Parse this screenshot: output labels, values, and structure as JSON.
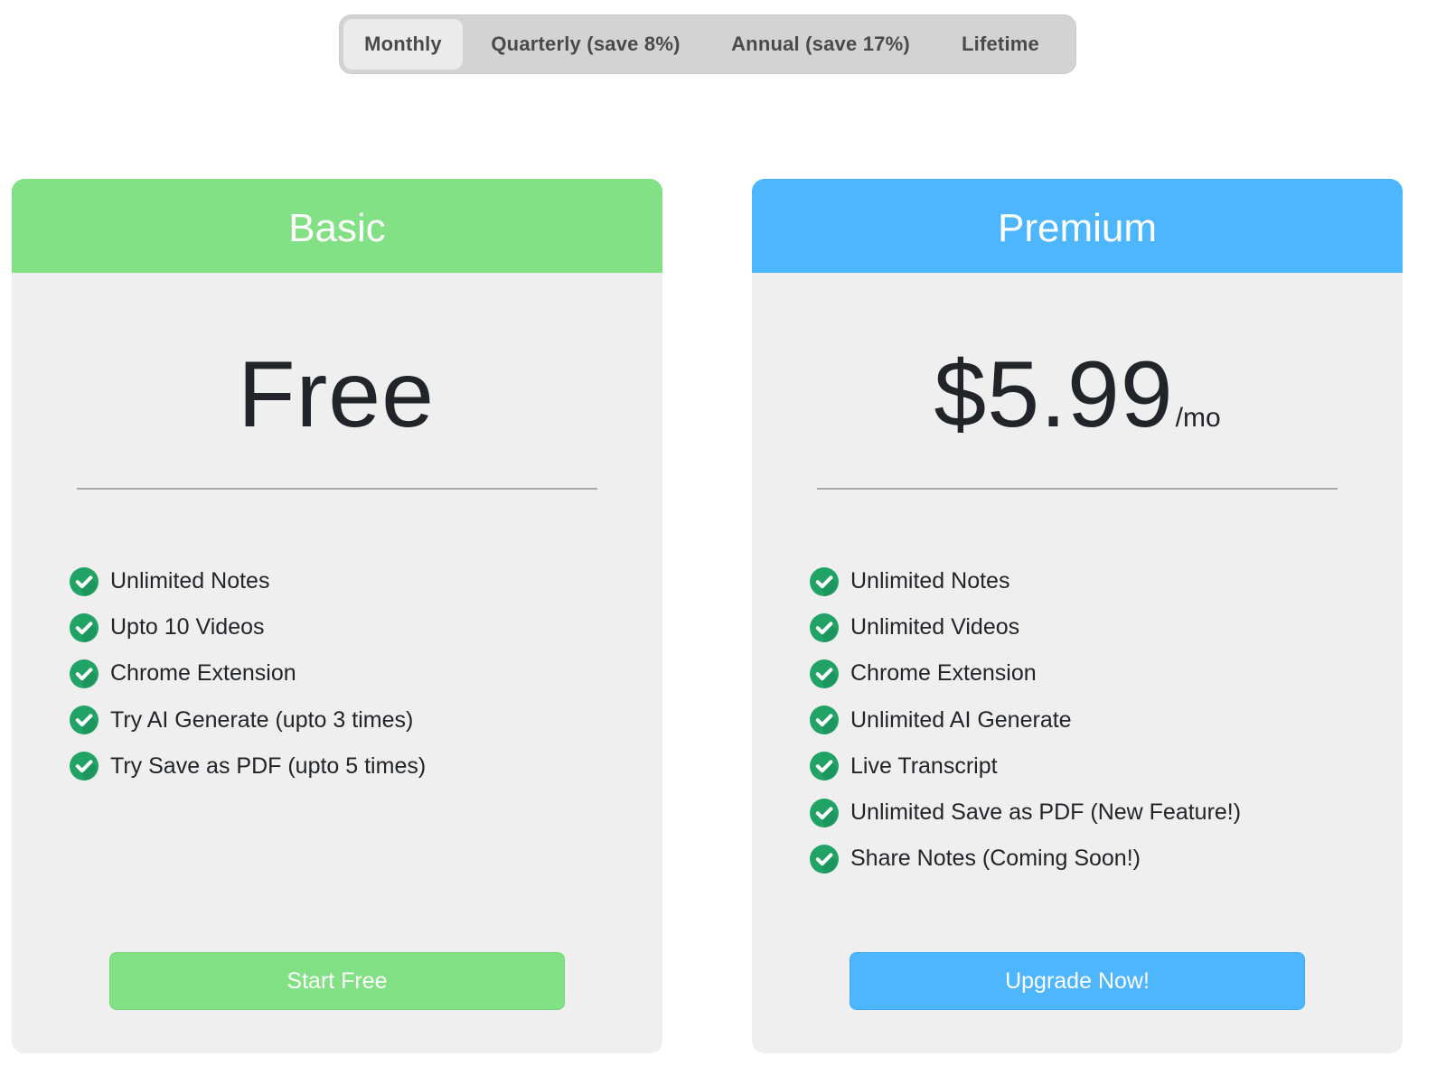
{
  "billing_toggle": {
    "options": [
      {
        "label": "Monthly",
        "selected": true
      },
      {
        "label": "Quarterly (save 8%)",
        "selected": false
      },
      {
        "label": "Annual (save 17%)",
        "selected": false
      },
      {
        "label": "Lifetime",
        "selected": false
      }
    ]
  },
  "plans": [
    {
      "name": "Basic",
      "price": "Free",
      "period": "",
      "header_color": "#82e085",
      "features": [
        "Unlimited Notes",
        "Upto 10 Videos",
        "Chrome Extension",
        "Try AI Generate (upto 3 times)",
        "Try Save as PDF (upto 5 times)"
      ],
      "cta_label": "Start Free"
    },
    {
      "name": "Premium",
      "price": "$5.99",
      "period": "/mo",
      "header_color": "#4db6fd",
      "features": [
        "Unlimited Notes",
        "Unlimited Videos",
        "Chrome Extension",
        "Unlimited AI Generate",
        "Live Transcript",
        "Unlimited Save as PDF (New Feature!)",
        "Share Notes (Coming Soon!)"
      ],
      "cta_label": "Upgrade Now!"
    }
  ],
  "icons": {
    "feature_check": "check-circle-icon",
    "check_color": "#21a366"
  }
}
